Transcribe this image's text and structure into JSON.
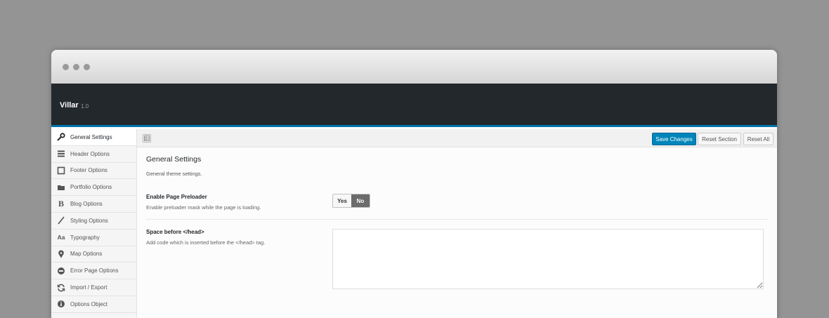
{
  "app": {
    "title": "Villar",
    "version": "1.0"
  },
  "sidebar": {
    "items": [
      {
        "label": "General Settings",
        "icon": "wrench-icon"
      },
      {
        "label": "Header Options",
        "icon": "menu-icon"
      },
      {
        "label": "Footer Options",
        "icon": "square-icon"
      },
      {
        "label": "Portfolio Options",
        "icon": "folder-icon"
      },
      {
        "label": "Blog Options",
        "icon": "bold-icon"
      },
      {
        "label": "Styling Options",
        "icon": "brush-icon"
      },
      {
        "label": "Typography",
        "icon": "typography-icon"
      },
      {
        "label": "Map Options",
        "icon": "map-pin-icon"
      },
      {
        "label": "Error Page Options",
        "icon": "minus-circle-icon"
      },
      {
        "label": "Import / Export",
        "icon": "refresh-icon"
      },
      {
        "label": "Options Object",
        "icon": "info-icon"
      }
    ]
  },
  "toolbar": {
    "save_label": "Save Changes",
    "reset_section_label": "Reset Section",
    "reset_all_label": "Reset All"
  },
  "section": {
    "title": "General Settings",
    "description": "General theme settings."
  },
  "fields": {
    "preloader": {
      "title": "Enable Page Preloader",
      "description": "Enable preloader mask while the page is loading.",
      "yes_label": "Yes",
      "no_label": "No",
      "value": "No"
    },
    "head_code": {
      "title": "Space before </head>",
      "description": "Add code which is inserted before the </head> tag.",
      "value": ""
    }
  },
  "colors": {
    "header_bg": "#23282d",
    "accent": "#0073aa",
    "primary_button": "#0085ba"
  }
}
